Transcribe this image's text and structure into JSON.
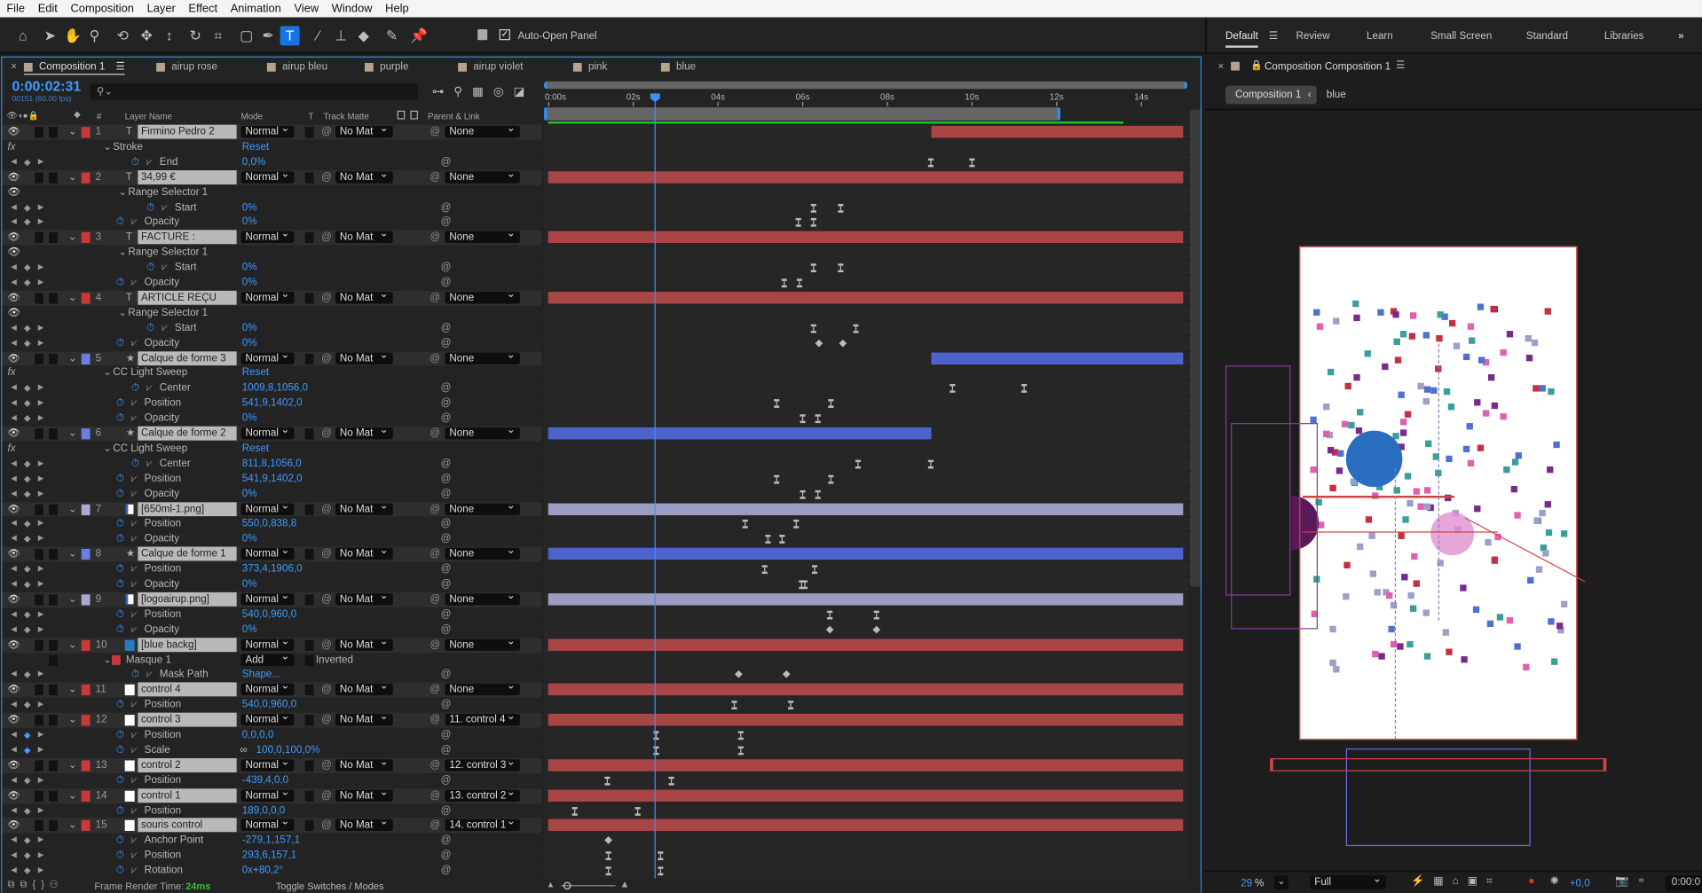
{
  "menu": [
    "File",
    "Edit",
    "Composition",
    "Layer",
    "Effect",
    "Animation",
    "View",
    "Window",
    "Help"
  ],
  "toolbar": {
    "tools": [
      "home",
      "selection",
      "hand",
      "zoom",
      "orbit",
      "pan",
      "dolly",
      "rotate",
      "anchor",
      "rectangle",
      "pen",
      "type",
      "brush",
      "clone",
      "eraser",
      "roto",
      "puppet"
    ],
    "active": "type",
    "auto_open": "Auto-Open Panel"
  },
  "workspaces": {
    "items": [
      "Default",
      "Review",
      "Learn",
      "Small Screen",
      "Standard",
      "Libraries"
    ],
    "active": "Default",
    "more": "»"
  },
  "timeline": {
    "tabs": [
      "Composition 1",
      "airup rose",
      "airup bleu",
      "purple",
      "airup violet",
      "pink",
      "blue"
    ],
    "active_tab": "Composition 1",
    "timecode": "0:00:02:31",
    "frame_info": "00151 (60.00 fps)",
    "search_placeholder": "",
    "headers": {
      "num": "#",
      "layer_name": "Layer Name",
      "mode": "Mode",
      "t": "T",
      "track_matte": "Track Matte",
      "parent": "Parent & Link"
    },
    "ruler": {
      "labels": [
        "0:00s",
        "02s",
        "04s",
        "06s",
        "08s",
        "10s",
        "12s",
        "14s"
      ],
      "duration_s": 15,
      "current_time_s": 2.517,
      "work_area_end_s": 12.1,
      "rendered_end_s": 13.6
    },
    "footer": {
      "render_label": "Frame Render Time:",
      "render_value": "24ms",
      "toggle": "Toggle Switches / Modes"
    },
    "colors": {
      "red": "#a94545",
      "blue": "#4c63cc",
      "lavender": "#9b9bc4",
      "accent": "#3d9bff",
      "label_red": "#c83a3a",
      "label_blue": "#6b7fe0",
      "label_lav": "#a9a9d6"
    },
    "rows": [
      {
        "kind": "layer",
        "num": "1",
        "name": "Firmino Pedro 2",
        "icon": "T",
        "label": "label_red",
        "mode": "Normal",
        "trk": "No Mat",
        "parent": "None",
        "bar": [
          9.04,
          15
        ],
        "barc": "red"
      },
      {
        "kind": "group",
        "fx": true,
        "lvl": 0,
        "name": "Stroke",
        "value": "Reset"
      },
      {
        "kind": "prop",
        "lvl": 1,
        "name": "End",
        "value": "0,0%",
        "keys": [
          9.03,
          10.0
        ]
      },
      {
        "kind": "layer",
        "num": "2",
        "name": "34,99 €",
        "icon": "T",
        "label": "label_red",
        "mode": "Normal",
        "trk": "No Mat",
        "parent": "None",
        "bar": [
          0,
          15
        ],
        "barc": "red"
      },
      {
        "kind": "group",
        "eye": true,
        "lvl": 1,
        "name": "Range Selector 1",
        "value": ""
      },
      {
        "kind": "prop",
        "lvl": 2,
        "name": "Start",
        "value": "0%",
        "keys": [
          6.26,
          6.9
        ]
      },
      {
        "kind": "prop",
        "lvl": 0,
        "name": "Opacity",
        "value": "0%",
        "keys": [
          5.9,
          6.26
        ]
      },
      {
        "kind": "layer",
        "num": "3",
        "name": "FACTURE :",
        "icon": "T",
        "label": "label_red",
        "mode": "Normal",
        "trk": "No Mat",
        "parent": "None",
        "bar": [
          0,
          15
        ],
        "barc": "red"
      },
      {
        "kind": "group",
        "eye": true,
        "lvl": 1,
        "name": "Range Selector 1",
        "value": ""
      },
      {
        "kind": "prop",
        "lvl": 2,
        "name": "Start",
        "value": "0%",
        "keys": [
          6.26,
          6.9
        ]
      },
      {
        "kind": "prop",
        "lvl": 0,
        "name": "Opacity",
        "value": "0%",
        "keys": [
          5.56,
          5.92
        ]
      },
      {
        "kind": "layer",
        "num": "4",
        "name": "ARTICLE REÇU",
        "icon": "T",
        "label": "label_red",
        "mode": "Normal",
        "trk": "No Mat",
        "parent": "None",
        "bar": [
          0,
          15
        ],
        "barc": "red"
      },
      {
        "kind": "group",
        "eye": true,
        "lvl": 1,
        "name": "Range Selector 1",
        "value": ""
      },
      {
        "kind": "prop",
        "lvl": 2,
        "name": "Start",
        "value": "0%",
        "keys": [
          6.26,
          7.26
        ]
      },
      {
        "kind": "prop",
        "lvl": 0,
        "name": "Opacity",
        "value": "0%",
        "keys": [
          6.38,
          6.95
        ],
        "ktype": "linear"
      },
      {
        "kind": "layer",
        "num": "5",
        "name": "Calque de forme 3",
        "icon": "★",
        "label": "label_blue",
        "mode": "Normal",
        "trk": "No Mat",
        "parent": "None",
        "bar": [
          9.04,
          15
        ],
        "barc": "blue"
      },
      {
        "kind": "group",
        "fx": true,
        "lvl": 0,
        "name": "CC Light Sweep",
        "value": "Reset"
      },
      {
        "kind": "prop",
        "lvl": 1,
        "name": "Center",
        "value": "1009,8,1056,0",
        "keys": [
          9.54,
          11.23
        ]
      },
      {
        "kind": "prop",
        "lvl": 0,
        "name": "Position",
        "value": "541,9,1402,0",
        "keys": [
          5.38,
          6.67
        ]
      },
      {
        "kind": "prop",
        "lvl": 0,
        "name": "Opacity",
        "value": "0%",
        "keys": [
          6.0,
          6.36
        ]
      },
      {
        "kind": "layer",
        "num": "6",
        "name": "Calque de forme 2",
        "icon": "★",
        "label": "label_blue",
        "mode": "Normal",
        "trk": "No Mat",
        "parent": "None",
        "bar": [
          0,
          9.04
        ],
        "barc": "blue"
      },
      {
        "kind": "group",
        "fx": true,
        "lvl": 0,
        "name": "CC Light Sweep",
        "value": "Reset"
      },
      {
        "kind": "prop",
        "lvl": 1,
        "name": "Center",
        "value": "811,8,1056,0",
        "keys": [
          7.31,
          9.03
        ]
      },
      {
        "kind": "prop",
        "lvl": 0,
        "name": "Position",
        "value": "541,9,1402,0",
        "keys": [
          5.38,
          6.67
        ]
      },
      {
        "kind": "prop",
        "lvl": 0,
        "name": "Opacity",
        "value": "0%",
        "keys": [
          6.0,
          6.36
        ]
      },
      {
        "kind": "layer",
        "num": "7",
        "name": "[650ml-1.png]",
        "icon": "file",
        "label": "label_lav",
        "mode": "Normal",
        "trk": "No Mat",
        "parent": "None",
        "bar": [
          0,
          15
        ],
        "barc": "lavender"
      },
      {
        "kind": "prop",
        "lvl": 0,
        "name": "Position",
        "value": "550,0,838,8",
        "keys": [
          4.64,
          5.85
        ]
      },
      {
        "kind": "prop",
        "lvl": 0,
        "name": "Opacity",
        "value": "0%",
        "keys": [
          5.18,
          5.51
        ]
      },
      {
        "kind": "layer",
        "num": "8",
        "name": "Calque de forme 1",
        "icon": "★",
        "label": "label_blue",
        "mode": "Normal",
        "trk": "No Mat",
        "parent": "None",
        "bar": [
          0,
          15
        ],
        "barc": "blue"
      },
      {
        "kind": "prop",
        "lvl": 0,
        "name": "Position",
        "value": "373,4,1906,0",
        "keys": [
          5.1,
          6.28
        ]
      },
      {
        "kind": "prop",
        "lvl": 0,
        "name": "Opacity",
        "value": "0%",
        "keys": [
          5.97,
          6.05
        ]
      },
      {
        "kind": "layer",
        "num": "9",
        "name": "[logoairup.png]",
        "icon": "file",
        "label": "label_lav",
        "mode": "Normal",
        "trk": "No Mat",
        "parent": "None",
        "bar": [
          0,
          15
        ],
        "barc": "lavender"
      },
      {
        "kind": "prop",
        "lvl": 0,
        "name": "Position",
        "value": "540,0,960,0",
        "keys": [
          6.64,
          7.74
        ]
      },
      {
        "kind": "prop",
        "lvl": 0,
        "name": "Opacity",
        "value": "0%",
        "keys": [
          6.64,
          7.74
        ],
        "ktype": "linear"
      },
      {
        "kind": "layer",
        "num": "10",
        "name": "[blue backg]",
        "icon": "solid-blue",
        "label": "label_red",
        "mode": "Normal",
        "trk": "No Mat",
        "parent": "None",
        "bar": [
          0,
          15
        ],
        "barc": "red"
      },
      {
        "kind": "mask",
        "name": "Masque 1",
        "mode": "Add",
        "inverted": "Inverted"
      },
      {
        "kind": "prop",
        "lvl": 1,
        "name": "Mask Path",
        "value": "Shape...",
        "keys": [
          4.49,
          5.62
        ],
        "ktype": "linear"
      },
      {
        "kind": "layer",
        "num": "11",
        "name": "control 4",
        "icon": "solid-white",
        "label": "label_red",
        "mode": "Normal",
        "trk": "No Mat",
        "parent": "None",
        "bar": [
          0,
          15
        ],
        "barc": "red"
      },
      {
        "kind": "prop",
        "lvl": 0,
        "name": "Position",
        "value": "540,0,960,0",
        "keys": [
          4.38,
          5.72
        ]
      },
      {
        "kind": "layer",
        "num": "12",
        "name": "control 3",
        "icon": "solid-white",
        "label": "label_red",
        "mode": "Normal",
        "trk": "No Mat",
        "parent": "11. control 4",
        "bar": [
          0,
          15
        ],
        "barc": "red"
      },
      {
        "kind": "prop",
        "lvl": 0,
        "name": "Position",
        "value": "0,0,0,0",
        "keys": [
          2.54,
          4.54
        ],
        "active": true
      },
      {
        "kind": "prop",
        "lvl": 0,
        "name": "Scale",
        "value": "100,0,100,0%",
        "link": true,
        "keys": [
          2.54,
          4.54
        ],
        "active": true
      },
      {
        "kind": "layer",
        "num": "13",
        "name": "control 2",
        "icon": "solid-white",
        "label": "label_red",
        "mode": "Normal",
        "trk": "No Mat",
        "parent": "12. control 3",
        "bar": [
          0,
          15
        ],
        "barc": "red"
      },
      {
        "kind": "prop",
        "lvl": 0,
        "name": "Position",
        "value": "-439,4,0,0",
        "keys": [
          1.38,
          2.9
        ]
      },
      {
        "kind": "layer",
        "num": "14",
        "name": "control 1",
        "icon": "solid-white",
        "label": "label_red",
        "mode": "Normal",
        "trk": "No Mat",
        "parent": "13. control 2",
        "bar": [
          0,
          15
        ],
        "barc": "red"
      },
      {
        "kind": "prop",
        "lvl": 0,
        "name": "Position",
        "value": "189,0,0,0",
        "keys": [
          0.62,
          2.1
        ]
      },
      {
        "kind": "layer",
        "num": "15",
        "name": "souris control",
        "icon": "solid-white",
        "label": "label_red",
        "mode": "Normal",
        "trk": "No Mat",
        "parent": "14. control 1",
        "bar": [
          0,
          15
        ],
        "barc": "red"
      },
      {
        "kind": "prop",
        "lvl": 0,
        "name": "Anchor Point",
        "value": "-279,1,157,1",
        "keys": [
          1.41
        ],
        "ktype": "linear"
      },
      {
        "kind": "prop",
        "lvl": 0,
        "name": "Position",
        "value": "293,6,157,1",
        "keys": [
          1.41,
          2.64
        ]
      },
      {
        "kind": "prop",
        "lvl": 0,
        "name": "Rotation",
        "value": "0x+80,2°",
        "keys": [
          1.41,
          2.64
        ]
      }
    ]
  },
  "viewer": {
    "title": "Composition Composition 1",
    "breadcrumb": [
      "Composition 1",
      "blue"
    ],
    "zoom": "29",
    "zoom_unit": "%",
    "resolution": "Full",
    "exposure": "+0,0",
    "timecode": "0:00:0"
  }
}
